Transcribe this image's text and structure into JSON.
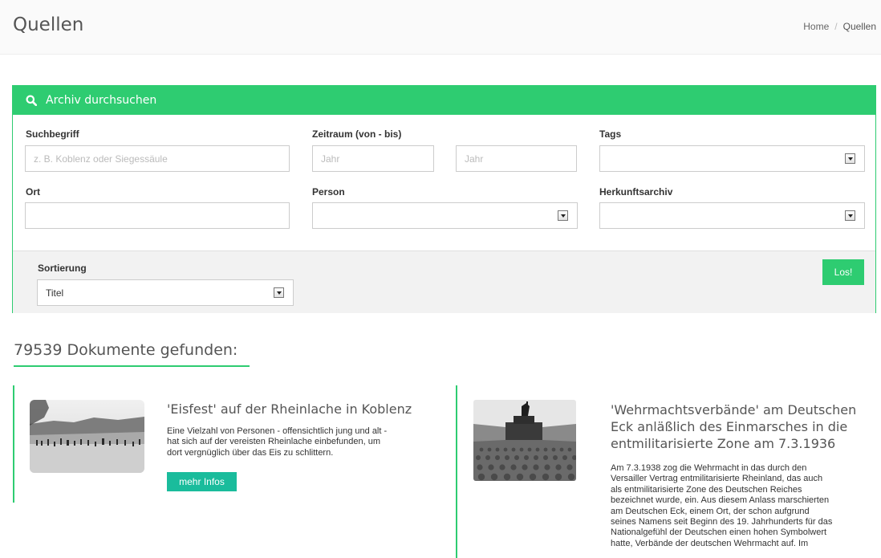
{
  "header": {
    "page_title": "Quellen",
    "breadcrumb": {
      "home": "Home",
      "separator": "/",
      "current": "Quellen"
    }
  },
  "search": {
    "title": "Archiv durchsuchen",
    "icon": "search-icon",
    "fields": {
      "suchbegriff": {
        "label": "Suchbegriff",
        "placeholder": "z. B. Koblenz oder Siegessäule",
        "value": ""
      },
      "zeitraum": {
        "label": "Zeitraum (von - bis)",
        "from_placeholder": "Jahr",
        "to_placeholder": "Jahr"
      },
      "tags": {
        "label": "Tags",
        "value": ""
      },
      "ort": {
        "label": "Ort",
        "value": ""
      },
      "person": {
        "label": "Person",
        "value": ""
      },
      "herkunftsarchiv": {
        "label": "Herkunftsarchiv",
        "value": ""
      }
    },
    "sort": {
      "label": "Sortierung",
      "value": "Titel"
    },
    "submit_label": "Los!"
  },
  "results": {
    "count_text": "79539 Dokumente gefunden:",
    "items": [
      {
        "title": "'Eisfest' auf der Rheinlache in Koblenz",
        "description_lines": [
          "Eine Vielzahl von Personen - offensichtlich jung und alt -",
          "hat sich auf der vereisten Rheinlache einbefunden, um",
          "dort vergnüglich über das Eis zu schlittern."
        ],
        "button_label": "mehr Infos"
      },
      {
        "title_lines": [
          "'Wehrmachtsverbände' am Deutschen",
          "Eck anläßlich des Einmarsches in die",
          "entmilitarisierte Zone am 7.3.1936"
        ],
        "description_lines": [
          "Am 7.3.1938 zog die Wehrmacht in das durch den",
          "Versailler Vertrag entmilitarisierte Rheinland, das auch",
          "als entmilitarisierte Zone des Deutschen Reiches",
          "bezeichnet wurde, ein. Aus diesem Anlass marschierten",
          "am Deutschen Eck, einem Ort, der schon aufgrund",
          "seines Namens seit Beginn des 19. Jahrhunderts für das",
          "Nationalgefühl der Deutschen einen hohen Symbolwert",
          "hatte, Verbände der deutschen Wehrmacht auf. Im"
        ]
      }
    ]
  },
  "colors": {
    "accent": "#2ecc71",
    "button_teal": "#1abc9c"
  }
}
